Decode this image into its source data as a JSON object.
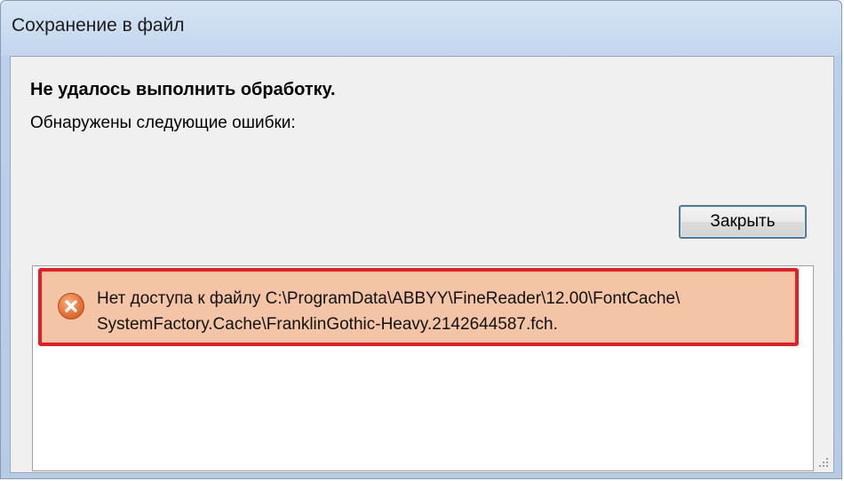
{
  "window": {
    "title": "Сохранение в файл"
  },
  "dialog": {
    "heading": "Не удалось выполнить обработку.",
    "subheading": "Обнаружены следующие ошибки:",
    "close_label": "Закрыть"
  },
  "errors": [
    {
      "icon": "error-icon",
      "line1": "Нет доступа к файлу C:\\ProgramData\\ABBYY\\FineReader\\12.00\\FontCache\\",
      "line2": "SystemFactory.Cache\\FranklinGothic-Heavy.2142644587.fch."
    }
  ],
  "colors": {
    "highlight_border": "#e41e24",
    "error_row_bg": "#f4c4a7",
    "error_icon": "#e5733a"
  }
}
